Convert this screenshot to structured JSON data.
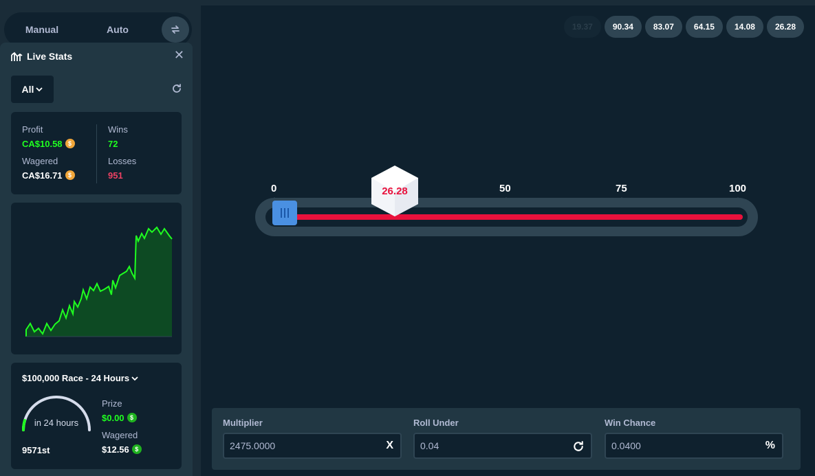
{
  "modes": {
    "manual": "Manual",
    "auto": "Auto"
  },
  "live_stats": {
    "title": "Live Stats",
    "filter": "All",
    "profit_label": "Profit",
    "profit_value": "CA$10.58",
    "wagered_label": "Wagered",
    "wagered_value": "CA$16.71",
    "wins_label": "Wins",
    "wins_value": "72",
    "losses_label": "Losses",
    "losses_value": "951"
  },
  "race": {
    "title": "$100,000 Race - 24 Hours",
    "gauge_text": "in 24 hours",
    "rank": "9571st",
    "prize_label": "Prize",
    "prize_value": "$0.00",
    "wagered_label": "Wagered",
    "wagered_value": "$12.56"
  },
  "history": [
    "19.37",
    "90.34",
    "83.07",
    "64.15",
    "14.08",
    "26.28"
  ],
  "slider": {
    "ticks": [
      "0",
      "50",
      "75",
      "100"
    ],
    "dice_value": "26.28",
    "roll_under": 0.04
  },
  "controls": {
    "multiplier_label": "Multiplier",
    "multiplier_value": "2475.0000",
    "multiplier_suffix": "X",
    "roll_under_label": "Roll Under",
    "roll_under_value": "0.04",
    "win_chance_label": "Win Chance",
    "win_chance_value": "0.0400",
    "win_chance_suffix": "%"
  },
  "colors": {
    "win": "#1fff20",
    "loss": "#e9113c",
    "handle": "#4a90e2"
  },
  "icons": [
    "swap-icon",
    "chart-icon",
    "close-icon",
    "chevron-down-icon",
    "refresh-icon",
    "coin-icon"
  ]
}
